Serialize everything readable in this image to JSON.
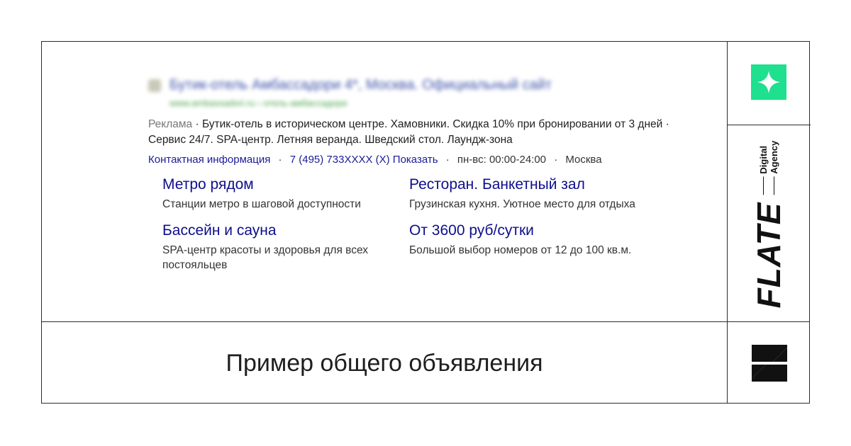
{
  "ad": {
    "blurred_title": "Бутик-отель Амбассадори 4*, Москва. Официальный сайт",
    "blurred_url": "www.ambassadori.ru › отель-амбассадори",
    "ad_label": "Реклама",
    "description_sep": " · ",
    "description": "Бутик-отель в историческом центре. Хамовники. Скидка 10% при бронировании от 3 дней · Сервис 24/7. SPA-центр. Летняя веранда. Шведский стол. Лаундж-зона",
    "separator": "·",
    "contacts": {
      "contact_link": "Контактная информация",
      "phone": "7 (495) 733XXXX (X) Показать",
      "hours": "пн-вс: 00:00-24:00",
      "city": "Москва"
    },
    "sitelinks": [
      {
        "title": "Метро рядом",
        "desc": "Станции метро в шаговой доступности"
      },
      {
        "title": "Ресторан. Банкетный зал",
        "desc": "Грузинская кухня. Уютное место для отдыха"
      },
      {
        "title": "Бассейн и сауна",
        "desc": "SPA-центр красоты и здоровья для всех постояльцев"
      },
      {
        "title": "От 3600 руб/сутки",
        "desc": "Большой выбор номеров от 12 до 100 кв.м."
      }
    ]
  },
  "caption": "Пример общего объявления",
  "brand": {
    "name": "FLATE",
    "sub1": "Digital",
    "sub2": "Agency"
  },
  "icons": {
    "star": "four-point-star-icon",
    "logo": "z-logo-icon"
  },
  "colors": {
    "accent": "#1ee08e",
    "sitelink": "#0e0e8c",
    "border": "#2b2b2b"
  }
}
